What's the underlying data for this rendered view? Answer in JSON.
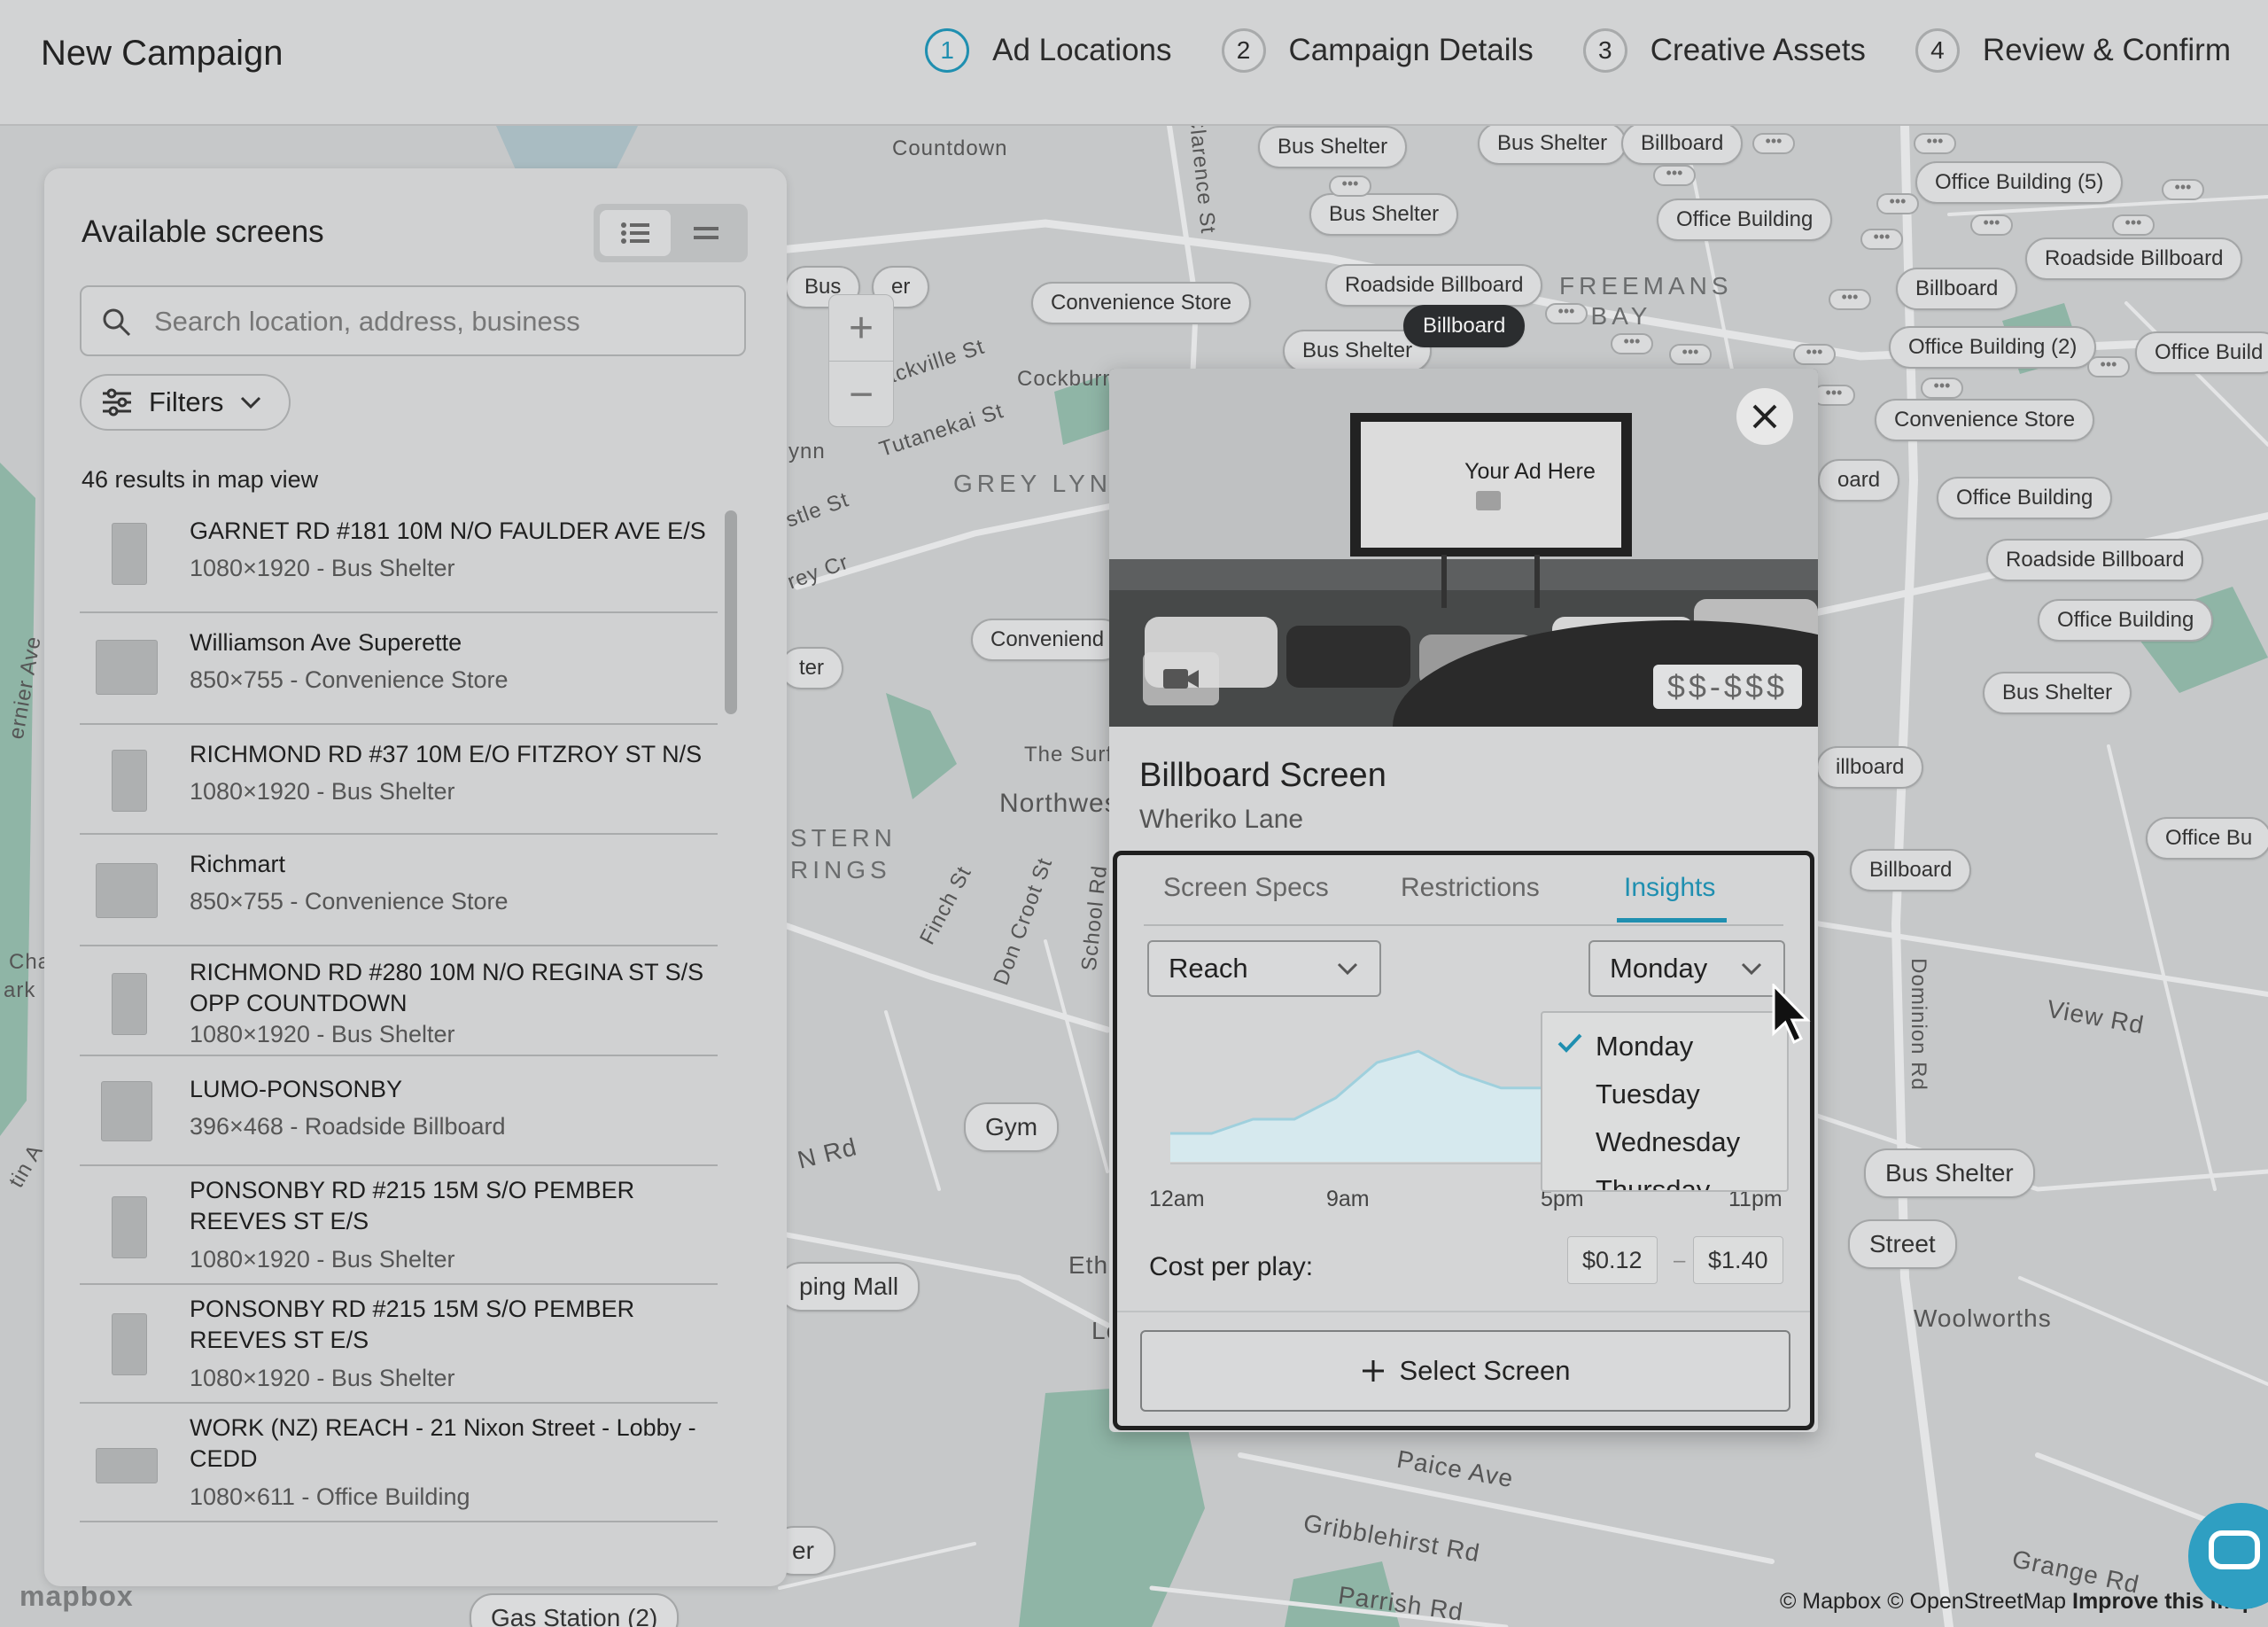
{
  "header": {
    "title": "New Campaign",
    "steps": [
      {
        "num": "1",
        "label": "Ad Locations"
      },
      {
        "num": "2",
        "label": "Campaign Details"
      },
      {
        "num": "3",
        "label": "Creative Assets"
      },
      {
        "num": "4",
        "label": "Review & Confirm"
      }
    ]
  },
  "colors": {
    "accent": "#1f8fb0",
    "park": "#8fb5a6",
    "water": "#a9bcc2"
  },
  "map": {
    "places": [
      "Countdown",
      "FREEMANS BAY",
      "GREY LYNN",
      "Sackville St",
      "Tutanekai St",
      "Cockburn",
      "The Surf",
      "Northwes",
      "STERN RINGS",
      "Finch St",
      "Don Croot St",
      "School Rd",
      "Dominion Rd",
      "View Rd",
      "Paice Ave",
      "Gribblehirst Rd",
      "Parrish Rd",
      "Grange Rd",
      "Woolworths",
      "N Rd",
      "Eth",
      "Le",
      "Clarence St",
      "ynn",
      "stle St",
      "rey Cr",
      "Cha",
      "ark",
      "tin A",
      "ernier Ave"
    ],
    "pins": [
      "Bus Shelter",
      "Bus Shelter",
      "Billboard",
      "Bus Shelter",
      "Office Building (5)",
      "Office Building",
      "Roadside Billboard",
      "Roadside Billboard",
      "Convenience Store",
      "Bus Shelter",
      "Billboard",
      "Billboard",
      "Office Building (2)",
      "Office Build",
      "Convenience Store",
      "oard",
      "Office Building",
      "Roadside Billboard",
      "Office Building",
      "Conveniend",
      "ter",
      "Bus Shelter",
      "illboard",
      "Billboard",
      "Office Bu",
      "Gym",
      "Bus Shelter",
      "Street",
      "ping Mall",
      "Gas Station (2)",
      "er",
      "Bus",
      "er",
      "Office Building (2)"
    ],
    "zoom_in": "+",
    "zoom_out": "−",
    "attribution_prefix": "© Mapbox © OpenStreetMap",
    "attribution_link": "Improve this map",
    "logo": "mapbox"
  },
  "panel": {
    "title": "Available screens",
    "search_placeholder": "Search location, address, business",
    "filters_label": "Filters",
    "results_text": "46 results in map view",
    "items": [
      {
        "name": "GARNET RD #181 10M N/O FAULDER AVE E/S",
        "sub": "1080×1920 - Bus Shelter"
      },
      {
        "name": "Williamson Ave Superette",
        "sub": "850×755 - Convenience Store"
      },
      {
        "name": "RICHMOND RD #37 10M E/O FITZROY ST N/S",
        "sub": "1080×1920 - Bus Shelter"
      },
      {
        "name": "Richmart",
        "sub": "850×755 - Convenience Store"
      },
      {
        "name": "RICHMOND RD #280 10M N/O REGINA ST S/S OPP COUNTDOWN",
        "sub": "1080×1920 - Bus Shelter"
      },
      {
        "name": "LUMO-PONSONBY",
        "sub": "396×468 - Roadside Billboard"
      },
      {
        "name": "PONSONBY RD #215 15M S/O PEMBER REEVES ST E/S",
        "sub": "1080×1920 - Bus Shelter"
      },
      {
        "name": "PONSONBY RD #215 15M S/O PEMBER REEVES ST E/S",
        "sub": "1080×1920 - Bus Shelter"
      },
      {
        "name": "WORK (NZ) REACH - 21 Nixon Street - Lobby - CEDD",
        "sub": "1080×611 - Office Building"
      }
    ]
  },
  "popup": {
    "map_tag": "Billboard",
    "ad_placeholder": "Your Ad Here",
    "price_range": "$$-$$$",
    "title": "Billboard Screen",
    "subtitle": "Wheriko Lane",
    "tabs": [
      "Screen Specs",
      "Restrictions",
      "Insights"
    ],
    "active_tab": "Insights",
    "metric_select": "Reach",
    "day_select": "Monday",
    "day_options": [
      "Monday",
      "Tuesday",
      "Wednesday",
      "Thursday"
    ],
    "chart_ticks": [
      "12am",
      "9am",
      "5pm",
      "11pm"
    ],
    "cost_label": "Cost per play:",
    "cost_min": "$0.12",
    "cost_dash": "–",
    "cost_max": "$1.40",
    "select_button": "Select Screen"
  },
  "chart_data": {
    "type": "area",
    "x": [
      "12am",
      "2am",
      "4am",
      "6am",
      "8am",
      "9am",
      "10am",
      "12pm",
      "2pm",
      "3pm"
    ],
    "values": [
      0.2,
      0.2,
      0.3,
      0.3,
      0.45,
      0.7,
      0.78,
      0.62,
      0.52,
      0.52
    ],
    "xlabel": "",
    "ylabel": ""
  }
}
